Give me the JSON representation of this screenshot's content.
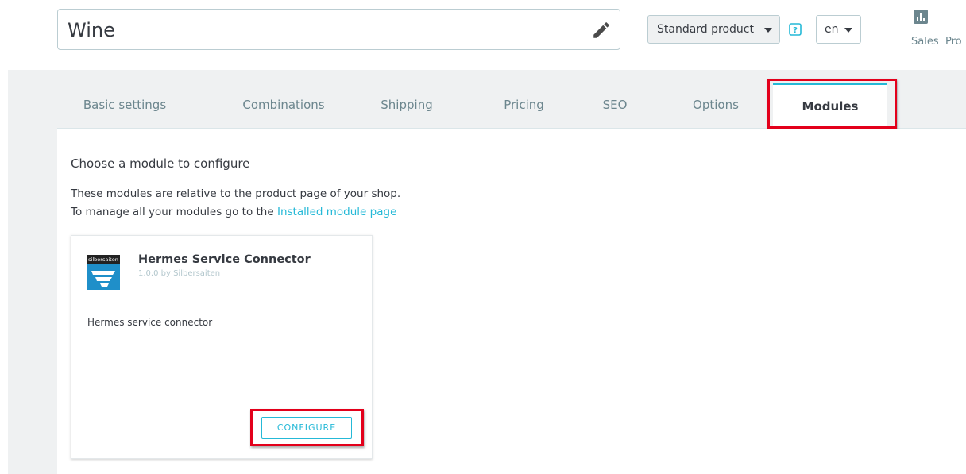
{
  "header": {
    "product_name": "Wine",
    "product_type": "Standard product",
    "language": "en",
    "sales_label": "Sales",
    "product_link_label": "Pro"
  },
  "tabs": [
    {
      "label": "Basic settings",
      "active": false
    },
    {
      "label": "Combinations",
      "active": false
    },
    {
      "label": "Shipping",
      "active": false
    },
    {
      "label": "Pricing",
      "active": false
    },
    {
      "label": "SEO",
      "active": false
    },
    {
      "label": "Options",
      "active": false
    },
    {
      "label": "Modules",
      "active": true
    }
  ],
  "modules_section": {
    "title": "Choose a module to configure",
    "description_line1": "These modules are relative to the product page of your shop.",
    "description_line2_prefix": "To manage all your modules go to the ",
    "installed_module_link": "Installed module page"
  },
  "module_card": {
    "logo_text": "silbersaiten",
    "name": "Hermes Service Connector",
    "version_author": "1.0.0 by Silbersaiten",
    "description": "Hermes service connector",
    "configure_label": "CONFIGURE"
  },
  "colors": {
    "accent": "#25b9d7",
    "highlight": "#e3001b",
    "background": "#eff1f2",
    "text": "#363a41",
    "muted_text": "#6c868e"
  },
  "icons": {
    "edit": "pencil-icon",
    "help": "help-icon",
    "sales": "bar-chart-icon",
    "dropdown": "caret-down-icon"
  }
}
